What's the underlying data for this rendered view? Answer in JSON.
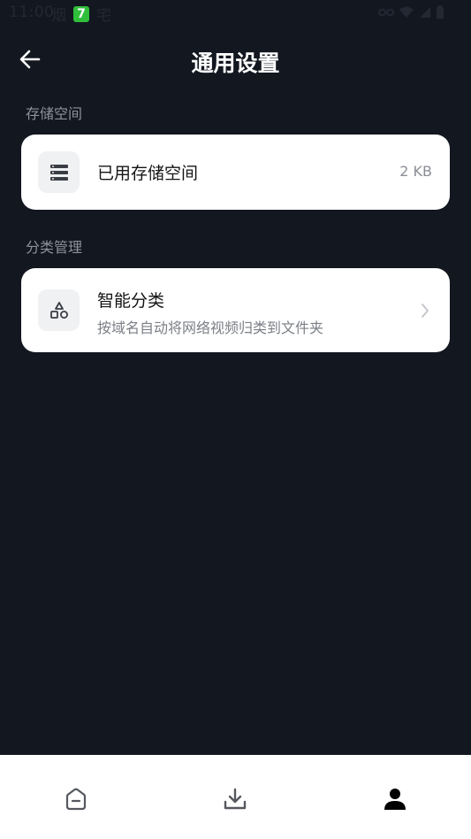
{
  "status_bar": {
    "time": "11:00",
    "notif_text_1": "烟",
    "app_badge": "7",
    "notif_text_2": "宅"
  },
  "header": {
    "title": "通用设置"
  },
  "storage_section": {
    "label": "存储空间",
    "item": {
      "title": "已用存储空间",
      "value": "2 KB"
    }
  },
  "category_section": {
    "label": "分类管理",
    "item": {
      "title": "智能分类",
      "subtitle": "按域名自动将网络视频归类到文件夹"
    }
  },
  "bottom_nav": {
    "items": [
      "home-icon",
      "download-icon",
      "profile-icon"
    ],
    "active_index": 2
  },
  "colors": {
    "background": "#131720",
    "card": "#ffffff",
    "accent_active": "#000000"
  }
}
